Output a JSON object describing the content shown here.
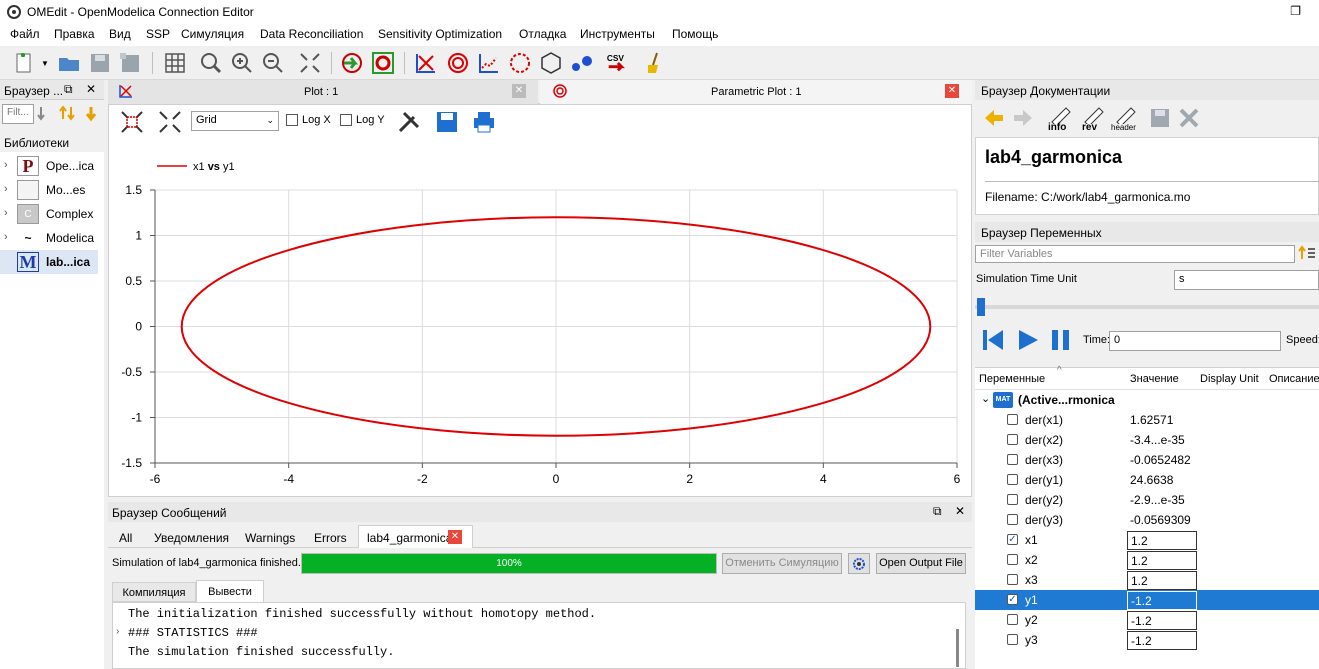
{
  "window": {
    "title": "OMEdit - OpenModelica Connection Editor",
    "restore_icon": "restore-icon"
  },
  "menu": [
    "Файл",
    "Правка",
    "Вид",
    "SSP",
    "Симуляция",
    "Data Reconciliation",
    "Sensitivity Optimization",
    "Отладка",
    "Инструменты",
    "Помощь"
  ],
  "toolbar": {
    "csv_label": "CSV"
  },
  "libraries": {
    "header": "Браузер ...",
    "filter_placeholder": "Filt...",
    "title": "Библиотеки",
    "items": [
      {
        "label": "Ope...ica",
        "badge": "P"
      },
      {
        "label": "Mo...es",
        "badge": ""
      },
      {
        "label": "Complex",
        "badge": "C"
      },
      {
        "label": "Modelica",
        "badge": "~"
      },
      {
        "label": "lab...ica",
        "badge": "M"
      }
    ]
  },
  "plot_tabs": {
    "tab1": "Plot : 1",
    "tab2": "Parametric Plot : 1"
  },
  "plot_toolbar": {
    "grid_value": "Grid",
    "logx": "Log X",
    "logy": "Log Y"
  },
  "chart_data": {
    "type": "line",
    "legend": {
      "series": "x1",
      "vs": "vs",
      "param": "y1"
    },
    "series": [
      {
        "name": "x1 vs y1",
        "shape": "ellipse",
        "x_semi_axis": 5.6,
        "y_semi_axis": 1.2,
        "color": "#e00000"
      }
    ],
    "xlim": [
      -6,
      6
    ],
    "ylim": [
      -1.5,
      1.5
    ],
    "xticks": [
      "-6",
      "-4",
      "-2",
      "0",
      "2",
      "4",
      "6"
    ],
    "yticks": [
      "1.5",
      "1",
      "0.5",
      "0",
      "-0.5",
      "-1",
      "-1.5"
    ],
    "grid": true
  },
  "messages": {
    "header": "Браузер Сообщений",
    "tabs": [
      "All",
      "Уведомления",
      "Warnings",
      "Errors",
      "lab4_garmonica"
    ],
    "status": "Simulation of lab4_garmonica finished.",
    "progress_label": "100%",
    "progress_value": 1.0,
    "cancel": "Отменить Симуляцию",
    "open_output": "Open Output File",
    "subtabs": [
      "Компиляция",
      "Вывести"
    ],
    "lines": [
      "The initialization finished successfully without homotopy method.",
      "### STATISTICS ###",
      "The simulation finished successfully."
    ]
  },
  "docs": {
    "header": "Браузер Документации",
    "btn_info": "info",
    "btn_rev": "rev",
    "btn_header": "header",
    "title": "lab4_garmonica",
    "filename": "Filename: C:/work/lab4_garmonica.mo"
  },
  "variables": {
    "header": "Браузер Переменных",
    "filter_placeholder": "Filter Variables",
    "time_unit_label": "Simulation Time Unit",
    "time_unit_value": "s",
    "time_label": "Time:",
    "time_value": "0",
    "speed_label": "Speed:",
    "columns": [
      "Переменные",
      "Значение",
      "Display Unit",
      "Описание"
    ],
    "root": "(Active...rmonica",
    "rows": [
      {
        "name": "der(x1)",
        "value": "1.62571",
        "checked": false,
        "editable": false
      },
      {
        "name": "der(x2)",
        "value": "-3.4...e-35",
        "checked": false,
        "editable": false
      },
      {
        "name": "der(x3)",
        "value": "-0.0652482",
        "checked": false,
        "editable": false
      },
      {
        "name": "der(y1)",
        "value": "24.6638",
        "checked": false,
        "editable": false
      },
      {
        "name": "der(y2)",
        "value": "-2.9...e-35",
        "checked": false,
        "editable": false
      },
      {
        "name": "der(y3)",
        "value": "-0.0569309",
        "checked": false,
        "editable": false
      },
      {
        "name": "x1",
        "value": "1.2",
        "checked": true,
        "editable": true
      },
      {
        "name": "x2",
        "value": "1.2",
        "checked": false,
        "editable": true
      },
      {
        "name": "x3",
        "value": "1.2",
        "checked": false,
        "editable": true
      },
      {
        "name": "y1",
        "value": "-1.2",
        "checked": true,
        "editable": true,
        "selected": true
      },
      {
        "name": "y2",
        "value": "-1.2",
        "checked": false,
        "editable": true
      },
      {
        "name": "y3",
        "value": "-1.2",
        "checked": false,
        "editable": true
      }
    ]
  }
}
